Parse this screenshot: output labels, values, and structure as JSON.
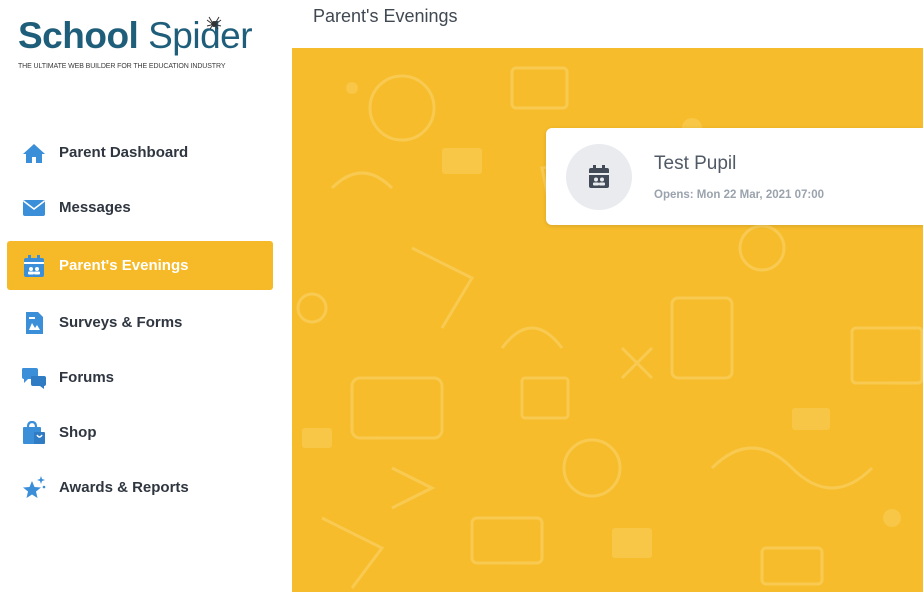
{
  "logo": {
    "title_bold": "School",
    "title_light": "Spider",
    "tagline": "THE ULTIMATE WEB BUILDER FOR THE EDUCATION INDUSTRY"
  },
  "header": {
    "title": "Parent's Evenings"
  },
  "sidebar": {
    "items": [
      {
        "label": "Parent Dashboard",
        "icon": "home-icon"
      },
      {
        "label": "Messages",
        "icon": "envelope-icon"
      },
      {
        "label": "Parent's Evenings",
        "icon": "calendar-icon",
        "active": true
      },
      {
        "label": "Surveys & Forms",
        "icon": "form-icon"
      },
      {
        "label": "Forums",
        "icon": "chat-bubbles-icon"
      },
      {
        "label": "Shop",
        "icon": "shopping-bag-icon"
      },
      {
        "label": "Awards & Reports",
        "icon": "sparkle-star-icon"
      }
    ]
  },
  "card": {
    "name": "Test Pupil",
    "opens": "Opens: Mon 22 Mar, 2021 07:00",
    "icon": "calendar-user-icon"
  },
  "colors": {
    "accent": "#f6b928",
    "brand": "#1f5e7a",
    "nav_icon": "#3b8ed8",
    "background_panel": "#f6bc2c"
  }
}
